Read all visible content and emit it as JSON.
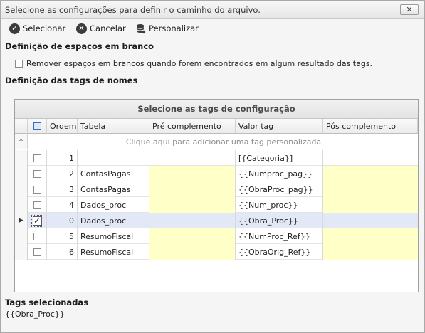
{
  "window": {
    "title": "Selecione as configurações para definir o caminho do arquivo.",
    "close_glyph": "✕"
  },
  "toolbar": {
    "select_label": "Selecionar",
    "cancel_label": "Cancelar",
    "customize_label": "Personalizar"
  },
  "whitespace": {
    "title": "Definição de espaços em branco",
    "option_label": "Remover espaços em brancos quando forem encontrados em algum resultado das tags.",
    "option_checked": false
  },
  "tags": {
    "title": "Definição das tags de nomes",
    "grid": {
      "group_header": "Selecione as tags de configuração",
      "columns": {
        "order": "Ordem",
        "table": "Tabela",
        "pre": "Pré complemento",
        "value": "Valor tag",
        "post": "Pós complemento"
      },
      "new_row_marker": "*",
      "new_row_hint": "Clique aqui para adicionar uma tag personalizada",
      "current_row_marker": "▶",
      "rows": [
        {
          "checked": false,
          "order": "1",
          "table": "",
          "pre": "",
          "value": "[{Categoria}]",
          "post": "",
          "highlight": false,
          "selected": false
        },
        {
          "checked": false,
          "order": "2",
          "table": "ContasPagas",
          "pre": "",
          "value": "{{Numproc_pag}}",
          "post": "",
          "highlight": true,
          "selected": false
        },
        {
          "checked": false,
          "order": "3",
          "table": "ContasPagas",
          "pre": "",
          "value": "{{ObraProc_pag}}",
          "post": "",
          "highlight": true,
          "selected": false
        },
        {
          "checked": false,
          "order": "4",
          "table": "Dados_proc",
          "pre": "",
          "value": "{{Num_proc}}",
          "post": "",
          "highlight": true,
          "selected": false
        },
        {
          "checked": true,
          "order": "0",
          "table": "Dados_proc",
          "pre": "",
          "value": "{{Obra_Proc}}",
          "post": "",
          "highlight": false,
          "selected": true
        },
        {
          "checked": false,
          "order": "5",
          "table": "ResumoFiscal",
          "pre": "",
          "value": "{{NumProc_Ref}}",
          "post": "",
          "highlight": true,
          "selected": false
        },
        {
          "checked": false,
          "order": "6",
          "table": "ResumoFiscal",
          "pre": "",
          "value": "{{ObraOrig_Ref}}",
          "post": "",
          "highlight": true,
          "selected": false
        }
      ]
    }
  },
  "selected_tags": {
    "title": "Tags selecionadas",
    "value": "{{Obra_Proc}}"
  },
  "colors": {
    "highlight_cell": "#ffffc8",
    "selected_row": "#e2e8f6"
  }
}
